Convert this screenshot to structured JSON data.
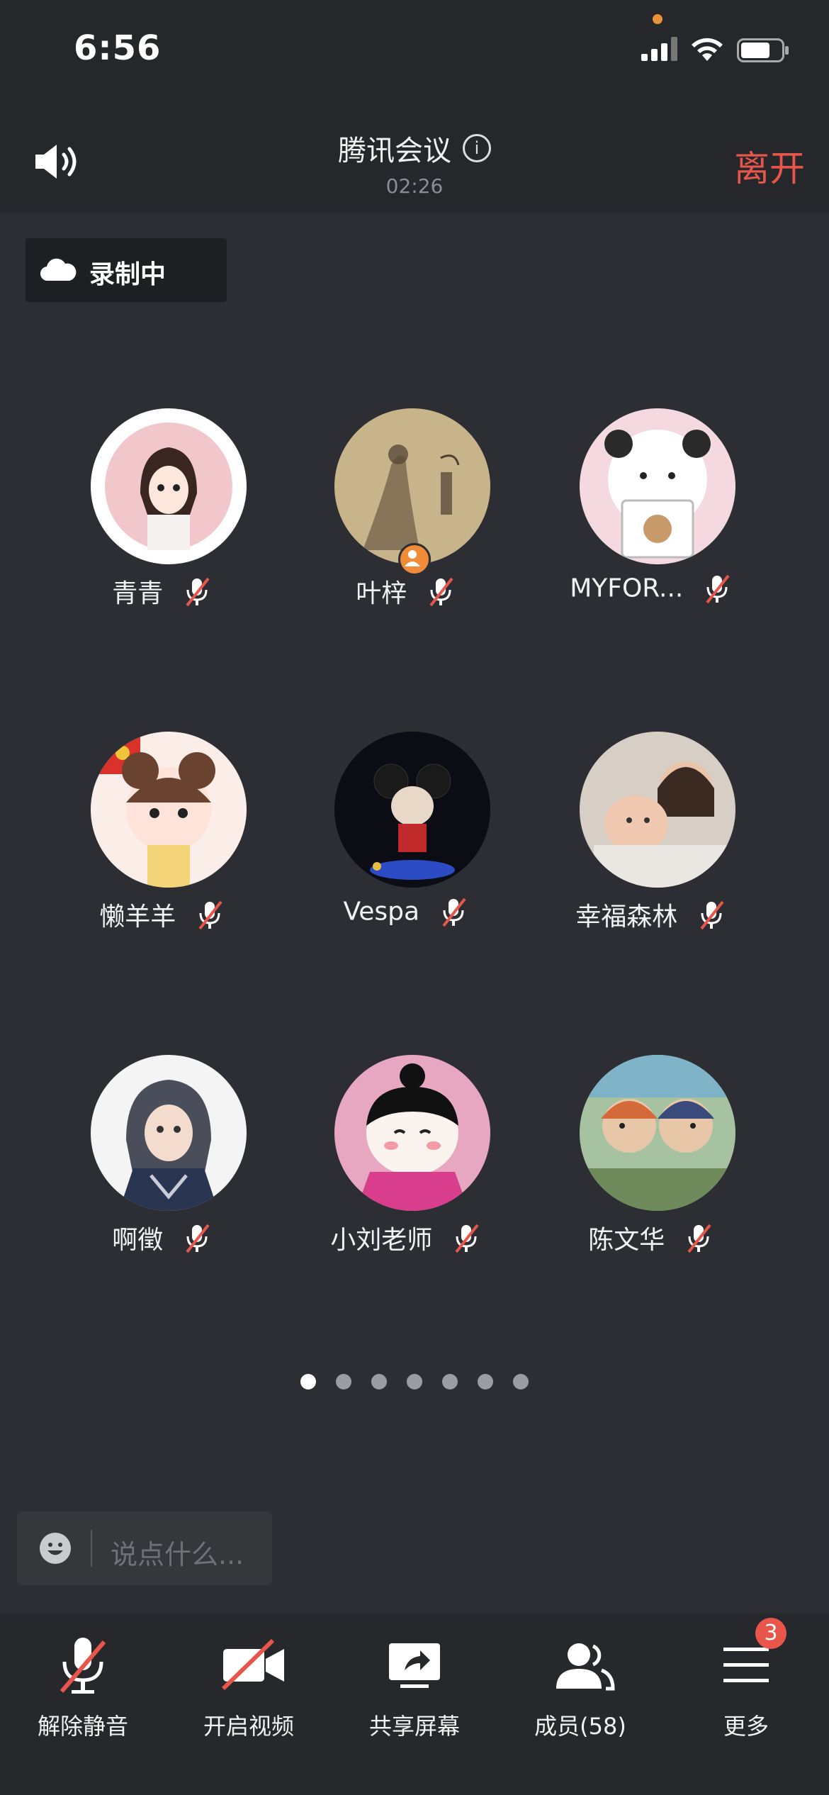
{
  "status_bar": {
    "time": "6:56"
  },
  "header": {
    "title": "腾讯会议",
    "timer": "02:26",
    "leave_label": "离开"
  },
  "recording": {
    "label": "录制中"
  },
  "participants": [
    {
      "name": "青青",
      "muted": true
    },
    {
      "name": "叶梓",
      "muted": true,
      "host": true
    },
    {
      "name": "MYFOR...",
      "muted": true
    },
    {
      "name": "懒羊羊",
      "muted": true
    },
    {
      "name": "Vespa",
      "muted": true
    },
    {
      "name": "幸福森林",
      "muted": true
    },
    {
      "name": "啊徵",
      "muted": true
    },
    {
      "name": "小刘老师",
      "muted": true
    },
    {
      "name": "陈文华",
      "muted": true
    }
  ],
  "pagination": {
    "pages": 7,
    "current": 1
  },
  "chat": {
    "placeholder": "说点什么..."
  },
  "toolbar": {
    "unmute_label": "解除静音",
    "video_label": "开启视频",
    "share_label": "共享屏幕",
    "members_label": "成员(58)",
    "more_label": "更多",
    "more_badge": "3"
  },
  "colors": {
    "accent_red": "#e8554a",
    "background": "#2c2e33"
  }
}
